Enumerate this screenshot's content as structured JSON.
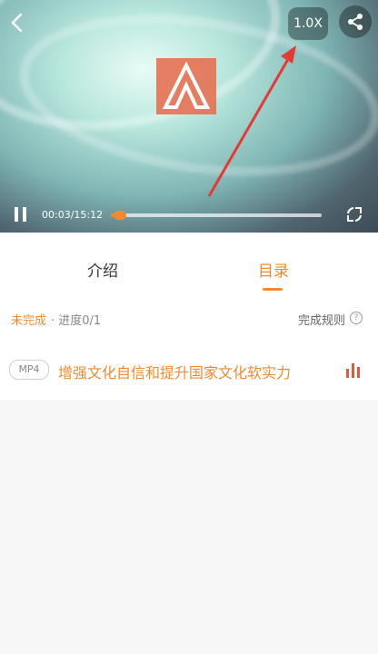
{
  "player": {
    "speed_label": "1.0X",
    "current_time": "00:03",
    "duration": "15:12",
    "time_display": "00:03/15:12",
    "progress": 0.0033
  },
  "tabs": [
    {
      "label": "介绍",
      "active": false
    },
    {
      "label": "目录",
      "active": true
    }
  ],
  "status": {
    "state": "未完成",
    "progress_text": "· 进度0/1",
    "rules_label": "完成规则"
  },
  "lessons": [
    {
      "badge": "MP4",
      "title": "增强文化自信和提升国家文化软实力",
      "playing": true
    }
  ],
  "colors": {
    "accent": "#f28b2f",
    "playing": "#e8573c"
  },
  "icons": {
    "back": "chevron-left-icon",
    "share": "share-icon",
    "pause": "pause-icon",
    "fullscreen": "fullscreen-icon",
    "help": "question-icon",
    "playing": "equalizer-icon"
  }
}
